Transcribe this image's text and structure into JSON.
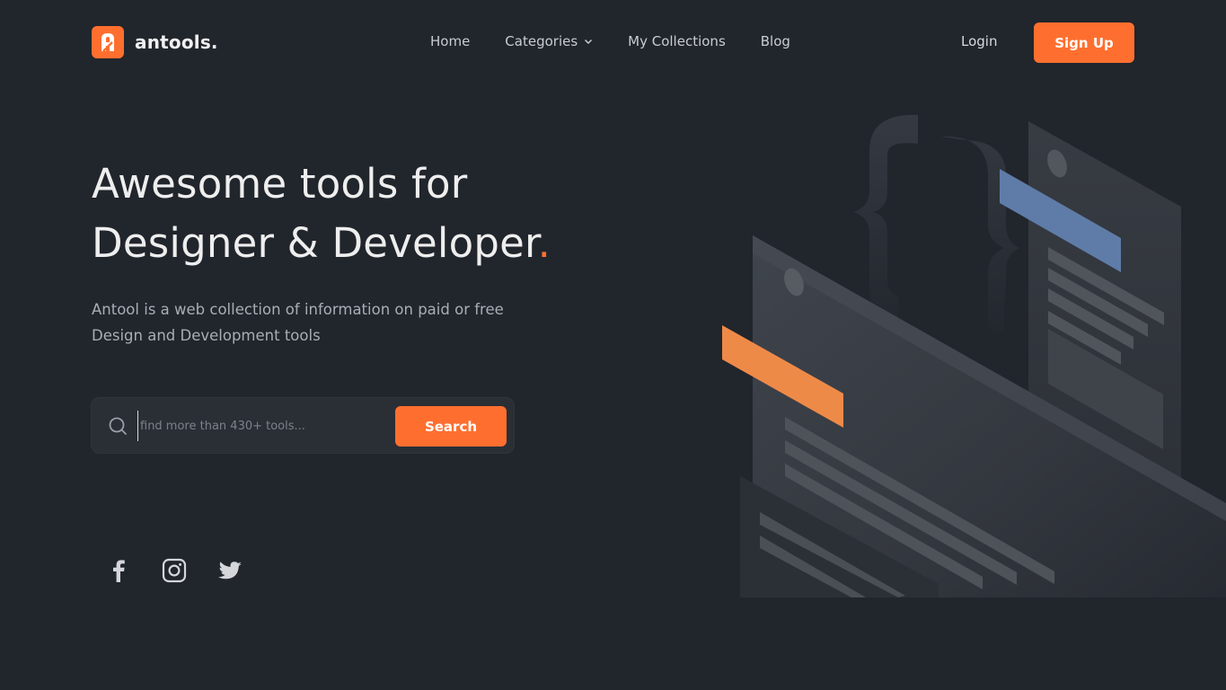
{
  "brand": {
    "name": "antools.",
    "accent": "#fe6f2f",
    "logo_icon": "antools-logo-icon"
  },
  "nav": {
    "home": "Home",
    "categories": "Categories",
    "collections": "My Collections",
    "blog": "Blog"
  },
  "auth": {
    "login": "Login",
    "signup": "Sign Up"
  },
  "hero": {
    "title_line1": "Awesome tools for",
    "title_line2": "Designer & Developer",
    "title_dot": ".",
    "subtitle": "Antool is a web collection of information on paid or free Design and Development tools"
  },
  "search": {
    "placeholder": "find more than 430+ tools...",
    "value": "",
    "button": "Search",
    "icon": "search-icon"
  },
  "social": [
    {
      "icon": "facebook-icon"
    },
    {
      "icon": "instagram-icon"
    },
    {
      "icon": "twitter-icon"
    }
  ],
  "illustration": {
    "colors": {
      "orange": "#ee8a48",
      "blue": "#5f7ca8"
    }
  }
}
